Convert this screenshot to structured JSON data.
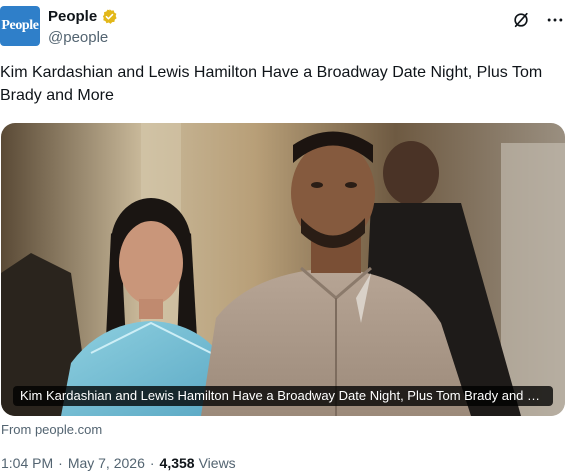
{
  "author": {
    "avatar_text": "People",
    "display_name": "People",
    "handle": "@people",
    "verified_badge_color": "#e2b719",
    "avatar_color": "#2f7fc9"
  },
  "header_actions": {
    "grok_icon": "slash-circle-icon",
    "more_icon": "more-dots-icon",
    "more_label": "···"
  },
  "tweet": {
    "text": "Kim Kardashian and Lewis Hamilton Have a Broadway Date Night, Plus Tom Brady and More"
  },
  "card": {
    "caption": "Kim Kardashian and Lewis Hamilton Have a Broadway Date Night, Plus Tom Brady and More",
    "source": "From people.com"
  },
  "meta": {
    "time": "1:04 PM",
    "date": "May 7, 2026",
    "separator": "·",
    "views_count": "4,358",
    "views_label": "Views"
  }
}
